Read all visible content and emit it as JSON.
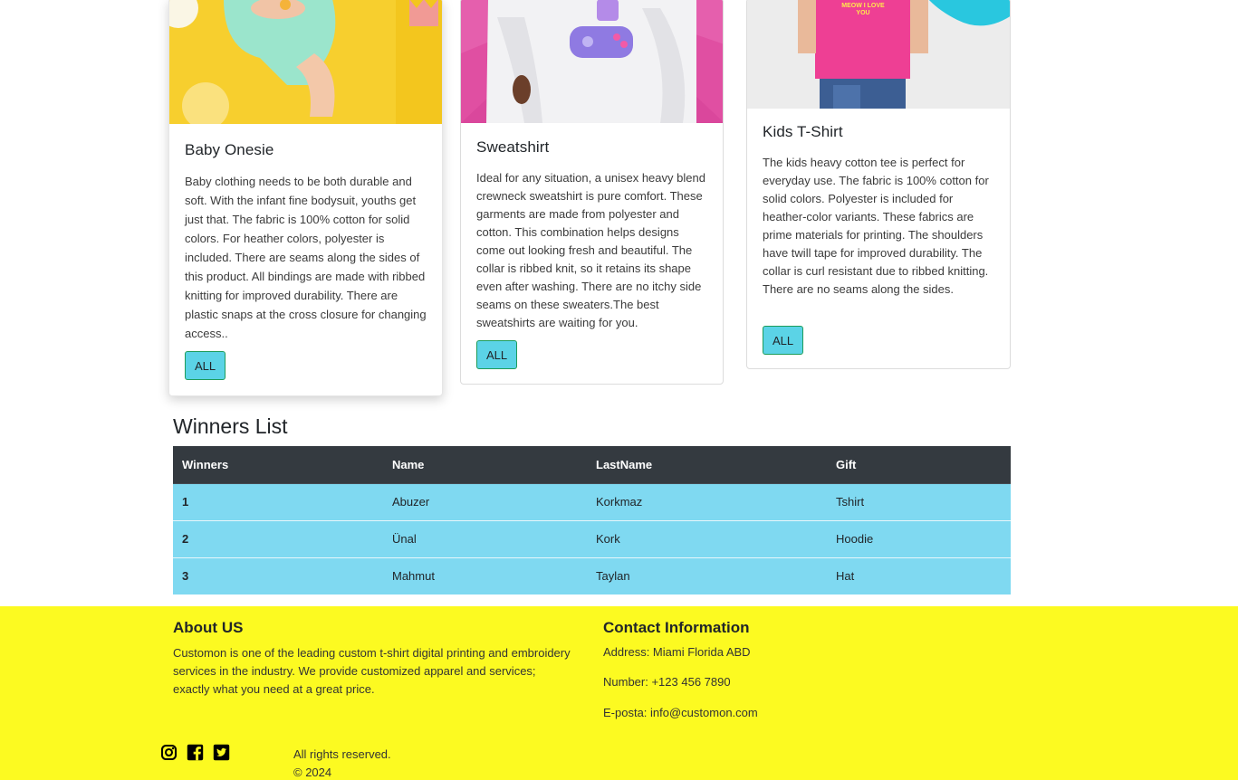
{
  "products": [
    {
      "title": "Baby Onesie",
      "description": "Baby clothing needs to be both durable and soft. With the infant fine bodysuit, youths get just that. The fabric is 100% cotton for solid colors. For heather colors, polyester is included. There are seams along the sides of this product. All bindings are made with ribbed knitting for improved durability. There are plastic snaps at the cross closure for changing access..",
      "button": "ALL"
    },
    {
      "title": "Sweatshirt",
      "description": "Ideal for any situation, a unisex heavy blend crewneck sweatshirt is pure comfort. These garments are made from polyester and cotton. This combination helps designs come out looking fresh and beautiful. The collar is ribbed knit, so it retains its shape even after washing. There are no itchy side seams on these sweaters.The best sweatshirts are waiting for you.",
      "button": "ALL"
    },
    {
      "title": "Kids T-Shirt",
      "description": "The kids heavy cotton tee is perfect for everyday use. The fabric is 100% cotton for solid colors. Polyester is included for heather-color variants. These fabrics are prime materials for printing. The shoulders have twill tape for improved durability. The collar is curl resistant due to ribbed knitting. There are no seams along the sides.",
      "button": "ALL",
      "shirt_print": "MEOW I LOVE YOU"
    }
  ],
  "winners": {
    "title": "Winners List",
    "headers": [
      "Winners",
      "Name",
      "LastName",
      "Gift"
    ],
    "rows": [
      [
        "1",
        "Abuzer",
        "Korkmaz",
        "Tshirt"
      ],
      [
        "2",
        "Ünal",
        "Kork",
        "Hoodie"
      ],
      [
        "3",
        "Mahmut",
        "Taylan",
        "Hat"
      ]
    ]
  },
  "footer": {
    "about_title": "About US",
    "about_text": "Customon is one of the leading custom t-shirt digital printing and embroidery services in the industry. We provide customized apparel and services; exactly what you need at a great price.",
    "contact_title": "Contact Information",
    "address": "Address: Miami Florida ABD",
    "number": "Number: +123 456 7890",
    "email": "E-posta: info@customon.com",
    "rights": "All rights reserved.",
    "copyright": "© 2024",
    "social_icons": [
      "instagram-icon",
      "facebook-icon",
      "twitter-icon"
    ]
  },
  "colors": {
    "footer_bg": "#fcfa21",
    "table_header_bg": "#343a40",
    "table_row_bg": "#7fd9f1",
    "button_bg": "#5bd3e6"
  }
}
